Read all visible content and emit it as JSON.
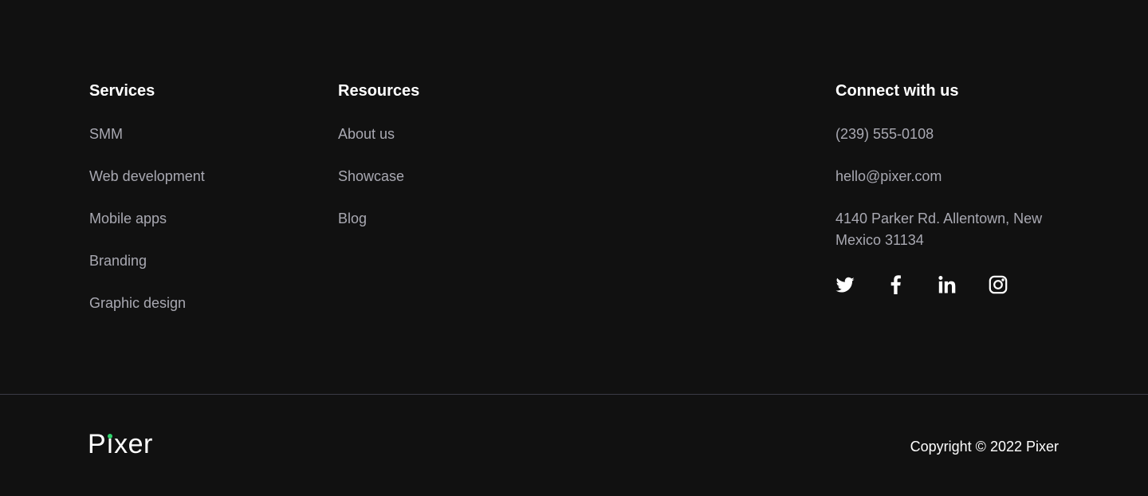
{
  "services": {
    "title": "Services",
    "items": [
      {
        "label": "SMM"
      },
      {
        "label": "Web development"
      },
      {
        "label": "Mobile apps"
      },
      {
        "label": "Branding"
      },
      {
        "label": "Graphic design"
      }
    ]
  },
  "resources": {
    "title": "Resources",
    "items": [
      {
        "label": "About us"
      },
      {
        "label": "Showcase"
      },
      {
        "label": "Blog"
      }
    ]
  },
  "connect": {
    "title": "Connect with us",
    "phone": "(239) 555-0108",
    "email": "hello@pixer.com",
    "address": "4140 Parker Rd. Allentown, New Mexico 31134",
    "socials": [
      {
        "icon": "twitter-icon"
      },
      {
        "icon": "facebook-icon"
      },
      {
        "icon": "linkedin-icon"
      },
      {
        "icon": "instagram-icon"
      }
    ]
  },
  "brand": {
    "logo_pre": "P",
    "logo_i": "ı",
    "logo_post": "xer",
    "logo_text": "Pixer",
    "accent_color": "#2fd36c"
  },
  "copyright": "Copyright © 2022 Pixer",
  "colors": {
    "background": "#111111",
    "link": "#a9a9b2",
    "heading": "#ffffff",
    "divider": "#3b3b45"
  }
}
